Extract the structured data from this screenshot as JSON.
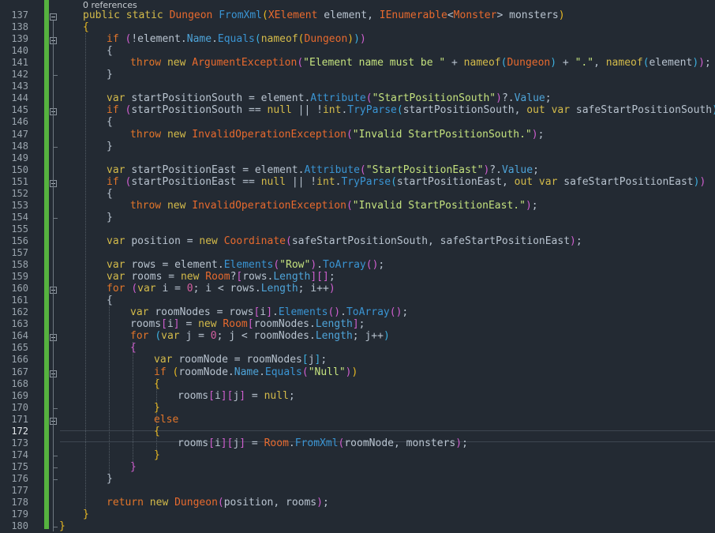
{
  "codelens": "0 references",
  "current_line": 172,
  "colors": {
    "background": "#232a33",
    "change_bar": "#56b23f",
    "keyword": "#e2752a",
    "type": "#e86a2e",
    "method": "#3a95d4",
    "string": "#c4e27e"
  },
  "line_numbers": [
    "137",
    "138",
    "139",
    "140",
    "141",
    "142",
    "143",
    "144",
    "145",
    "146",
    "147",
    "148",
    "149",
    "150",
    "151",
    "152",
    "153",
    "154",
    "155",
    "156",
    "157",
    "158",
    "159",
    "160",
    "161",
    "162",
    "163",
    "164",
    "165",
    "166",
    "167",
    "168",
    "169",
    "170",
    "171",
    "172",
    "173",
    "174",
    "175",
    "176",
    "177",
    "178",
    "179",
    "180"
  ],
  "code_lines": [
    {
      "ln": "137",
      "tokens": [
        [
          "kw2",
          "public "
        ],
        [
          "kw2",
          "static "
        ],
        [
          "ty",
          "Dungeon "
        ],
        [
          "fn",
          "FromXml"
        ],
        [
          "p1",
          "("
        ],
        [
          "ty",
          "XElement "
        ],
        [
          "id",
          "element, "
        ],
        [
          "ty",
          "IEnumerable"
        ],
        [
          "op",
          "<"
        ],
        [
          "ty",
          "Monster"
        ],
        [
          "op",
          "> "
        ],
        [
          "id",
          "monsters"
        ],
        [
          "p1",
          ")"
        ]
      ]
    },
    {
      "ln": "138",
      "tokens": [
        [
          "p1",
          "{"
        ]
      ]
    },
    {
      "ln": "139",
      "tokens": [
        [
          "kw",
          "if "
        ],
        [
          "p2",
          "("
        ],
        [
          "op",
          "!"
        ],
        [
          "id",
          "element."
        ],
        [
          "pr",
          "Name"
        ],
        [
          "id",
          "."
        ],
        [
          "fn",
          "Equals"
        ],
        [
          "p3",
          "("
        ],
        [
          "kw2",
          "nameof"
        ],
        [
          "p1",
          "("
        ],
        [
          "ty",
          "Dungeon"
        ],
        [
          "p1",
          ")"
        ],
        [
          "p3",
          ")"
        ],
        [
          "p2",
          ")"
        ]
      ]
    },
    {
      "ln": "140",
      "tokens": [
        [
          "op",
          "{"
        ]
      ]
    },
    {
      "ln": "141",
      "tokens": [
        [
          "kw",
          "throw "
        ],
        [
          "kw2",
          "new "
        ],
        [
          "ty",
          "ArgumentException"
        ],
        [
          "p2",
          "("
        ],
        [
          "str",
          "\"Element name must be \""
        ],
        [
          "op",
          " + "
        ],
        [
          "kw2",
          "nameof"
        ],
        [
          "p3",
          "("
        ],
        [
          "ty",
          "Dungeon"
        ],
        [
          "p3",
          ")"
        ],
        [
          "op",
          " + "
        ],
        [
          "str",
          "\".\""
        ],
        [
          "op",
          ", "
        ],
        [
          "kw2",
          "nameof"
        ],
        [
          "p3",
          "("
        ],
        [
          "id",
          "element"
        ],
        [
          "p3",
          ")"
        ],
        [
          "p2",
          ")"
        ],
        [
          "op",
          ";"
        ]
      ]
    },
    {
      "ln": "142",
      "tokens": [
        [
          "op",
          "}"
        ]
      ]
    },
    {
      "ln": "143",
      "tokens": []
    },
    {
      "ln": "144",
      "tokens": [
        [
          "kw2",
          "var "
        ],
        [
          "id",
          "startPositionSouth = element."
        ],
        [
          "fn",
          "Attribute"
        ],
        [
          "p2",
          "("
        ],
        [
          "str",
          "\"StartPositionSouth\""
        ],
        [
          "p2",
          ")"
        ],
        [
          "op",
          "?."
        ],
        [
          "pr",
          "Value"
        ],
        [
          "op",
          ";"
        ]
      ]
    },
    {
      "ln": "145",
      "tokens": [
        [
          "kw",
          "if "
        ],
        [
          "p2",
          "("
        ],
        [
          "id",
          "startPositionSouth == "
        ],
        [
          "kw2",
          "null"
        ],
        [
          "op",
          " || !"
        ],
        [
          "kw2",
          "int"
        ],
        [
          "op",
          "."
        ],
        [
          "fn",
          "TryParse"
        ],
        [
          "p3",
          "("
        ],
        [
          "id",
          "startPositionSouth, "
        ],
        [
          "kw2",
          "out var "
        ],
        [
          "id",
          "safeStartPositionSouth"
        ],
        [
          "p3",
          ")"
        ],
        [
          "p2",
          ")"
        ]
      ]
    },
    {
      "ln": "146",
      "tokens": [
        [
          "op",
          "{"
        ]
      ]
    },
    {
      "ln": "147",
      "tokens": [
        [
          "kw",
          "throw "
        ],
        [
          "kw2",
          "new "
        ],
        [
          "ty",
          "InvalidOperationException"
        ],
        [
          "p2",
          "("
        ],
        [
          "str",
          "\"Invalid StartPositionSouth.\""
        ],
        [
          "p2",
          ")"
        ],
        [
          "op",
          ";"
        ]
      ]
    },
    {
      "ln": "148",
      "tokens": [
        [
          "op",
          "}"
        ]
      ]
    },
    {
      "ln": "149",
      "tokens": []
    },
    {
      "ln": "150",
      "tokens": [
        [
          "kw2",
          "var "
        ],
        [
          "id",
          "startPositionEast = element."
        ],
        [
          "fn",
          "Attribute"
        ],
        [
          "p2",
          "("
        ],
        [
          "str",
          "\"StartPositionEast\""
        ],
        [
          "p2",
          ")"
        ],
        [
          "op",
          "?."
        ],
        [
          "pr",
          "Value"
        ],
        [
          "op",
          ";"
        ]
      ]
    },
    {
      "ln": "151",
      "tokens": [
        [
          "kw",
          "if "
        ],
        [
          "p2",
          "("
        ],
        [
          "id",
          "startPositionEast == "
        ],
        [
          "kw2",
          "null"
        ],
        [
          "op",
          " || !"
        ],
        [
          "kw2",
          "int"
        ],
        [
          "op",
          "."
        ],
        [
          "fn",
          "TryParse"
        ],
        [
          "p3",
          "("
        ],
        [
          "id",
          "startPositionEast, "
        ],
        [
          "kw2",
          "out var "
        ],
        [
          "id",
          "safeStartPositionEast"
        ],
        [
          "p3",
          ")"
        ],
        [
          "p2",
          ")"
        ]
      ]
    },
    {
      "ln": "152",
      "tokens": [
        [
          "op",
          "{"
        ]
      ]
    },
    {
      "ln": "153",
      "tokens": [
        [
          "kw",
          "throw "
        ],
        [
          "kw2",
          "new "
        ],
        [
          "ty",
          "InvalidOperationException"
        ],
        [
          "p2",
          "("
        ],
        [
          "str",
          "\"Invalid StartPositionEast.\""
        ],
        [
          "p2",
          ")"
        ],
        [
          "op",
          ";"
        ]
      ]
    },
    {
      "ln": "154",
      "tokens": [
        [
          "op",
          "}"
        ]
      ]
    },
    {
      "ln": "155",
      "tokens": []
    },
    {
      "ln": "156",
      "tokens": [
        [
          "kw2",
          "var "
        ],
        [
          "id",
          "position = "
        ],
        [
          "kw2",
          "new "
        ],
        [
          "ty",
          "Coordinate"
        ],
        [
          "p2",
          "("
        ],
        [
          "id",
          "safeStartPositionSouth, safeStartPositionEast"
        ],
        [
          "p2",
          ")"
        ],
        [
          "op",
          ";"
        ]
      ]
    },
    {
      "ln": "157",
      "tokens": []
    },
    {
      "ln": "158",
      "tokens": [
        [
          "kw2",
          "var "
        ],
        [
          "id",
          "rows = element."
        ],
        [
          "fn",
          "Elements"
        ],
        [
          "p2",
          "("
        ],
        [
          "str",
          "\"Row\""
        ],
        [
          "p2",
          ")"
        ],
        [
          "op",
          "."
        ],
        [
          "fn",
          "ToArray"
        ],
        [
          "p2",
          "()"
        ],
        [
          "op",
          ";"
        ]
      ]
    },
    {
      "ln": "159",
      "tokens": [
        [
          "kw2",
          "var "
        ],
        [
          "id",
          "rooms = "
        ],
        [
          "kw2",
          "new "
        ],
        [
          "ty",
          "Room"
        ],
        [
          "op",
          "?"
        ],
        [
          "p2",
          "["
        ],
        [
          "id",
          "rows."
        ],
        [
          "pr",
          "Length"
        ],
        [
          "p2",
          "]"
        ],
        [
          "p2",
          "[]"
        ],
        [
          "op",
          ";"
        ]
      ]
    },
    {
      "ln": "160",
      "tokens": [
        [
          "kw",
          "for "
        ],
        [
          "p2",
          "("
        ],
        [
          "kw2",
          "var "
        ],
        [
          "id",
          "i = "
        ],
        [
          "num",
          "0"
        ],
        [
          "op",
          "; "
        ],
        [
          "id",
          "i < rows."
        ],
        [
          "pr",
          "Length"
        ],
        [
          "op",
          "; "
        ],
        [
          "id",
          "i++"
        ],
        [
          "p2",
          ")"
        ]
      ]
    },
    {
      "ln": "161",
      "tokens": [
        [
          "op",
          "{"
        ]
      ]
    },
    {
      "ln": "162",
      "tokens": [
        [
          "kw2",
          "var "
        ],
        [
          "id",
          "roomNodes = rows"
        ],
        [
          "p2",
          "["
        ],
        [
          "id",
          "i"
        ],
        [
          "p2",
          "]"
        ],
        [
          "op",
          "."
        ],
        [
          "fn",
          "Elements"
        ],
        [
          "p2",
          "()"
        ],
        [
          "op",
          "."
        ],
        [
          "fn",
          "ToArray"
        ],
        [
          "p2",
          "()"
        ],
        [
          "op",
          ";"
        ]
      ]
    },
    {
      "ln": "163",
      "tokens": [
        [
          "id",
          "rooms"
        ],
        [
          "p2",
          "["
        ],
        [
          "id",
          "i"
        ],
        [
          "p2",
          "]"
        ],
        [
          "op",
          " = "
        ],
        [
          "kw2",
          "new "
        ],
        [
          "ty",
          "Room"
        ],
        [
          "p2",
          "["
        ],
        [
          "id",
          "roomNodes."
        ],
        [
          "pr",
          "Length"
        ],
        [
          "p2",
          "]"
        ],
        [
          "op",
          ";"
        ]
      ]
    },
    {
      "ln": "164",
      "tokens": [
        [
          "kw",
          "for "
        ],
        [
          "p3",
          "("
        ],
        [
          "kw2",
          "var "
        ],
        [
          "id",
          "j = "
        ],
        [
          "num",
          "0"
        ],
        [
          "op",
          "; "
        ],
        [
          "id",
          "j < roomNodes."
        ],
        [
          "pr",
          "Length"
        ],
        [
          "op",
          "; "
        ],
        [
          "id",
          "j++"
        ],
        [
          "p3",
          ")"
        ]
      ]
    },
    {
      "ln": "165",
      "tokens": [
        [
          "p2",
          "{"
        ]
      ]
    },
    {
      "ln": "166",
      "tokens": [
        [
          "kw2",
          "var "
        ],
        [
          "id",
          "roomNode = roomNodes"
        ],
        [
          "p3",
          "["
        ],
        [
          "id",
          "j"
        ],
        [
          "p3",
          "]"
        ],
        [
          "op",
          ";"
        ]
      ]
    },
    {
      "ln": "167",
      "tokens": [
        [
          "kw",
          "if "
        ],
        [
          "p1",
          "("
        ],
        [
          "id",
          "roomNode."
        ],
        [
          "pr",
          "Name"
        ],
        [
          "op",
          "."
        ],
        [
          "fn",
          "Equals"
        ],
        [
          "p2",
          "("
        ],
        [
          "str",
          "\"Null\""
        ],
        [
          "p2",
          ")"
        ],
        [
          "p1",
          ")"
        ]
      ]
    },
    {
      "ln": "168",
      "tokens": [
        [
          "p1",
          "{"
        ]
      ]
    },
    {
      "ln": "169",
      "tokens": [
        [
          "id",
          "rooms"
        ],
        [
          "p2",
          "["
        ],
        [
          "id",
          "i"
        ],
        [
          "p2",
          "]"
        ],
        [
          "p2",
          "["
        ],
        [
          "id",
          "j"
        ],
        [
          "p2",
          "]"
        ],
        [
          "op",
          " = "
        ],
        [
          "kw2",
          "null"
        ],
        [
          "op",
          ";"
        ]
      ]
    },
    {
      "ln": "170",
      "tokens": [
        [
          "p1",
          "}"
        ]
      ]
    },
    {
      "ln": "171",
      "tokens": [
        [
          "kw",
          "else"
        ]
      ]
    },
    {
      "ln": "172",
      "tokens": [
        [
          "p1",
          "{"
        ]
      ]
    },
    {
      "ln": "173",
      "tokens": [
        [
          "id",
          "rooms"
        ],
        [
          "p2",
          "["
        ],
        [
          "id",
          "i"
        ],
        [
          "p2",
          "]"
        ],
        [
          "p2",
          "["
        ],
        [
          "id",
          "j"
        ],
        [
          "p2",
          "]"
        ],
        [
          "op",
          " = "
        ],
        [
          "ty",
          "Room"
        ],
        [
          "op",
          "."
        ],
        [
          "fn",
          "FromXml"
        ],
        [
          "p2",
          "("
        ],
        [
          "id",
          "roomNode, monsters"
        ],
        [
          "p2",
          ")"
        ],
        [
          "op",
          ";"
        ]
      ]
    },
    {
      "ln": "174",
      "tokens": [
        [
          "p1",
          "}"
        ]
      ]
    },
    {
      "ln": "175",
      "tokens": [
        [
          "p2",
          "}"
        ]
      ]
    },
    {
      "ln": "176",
      "tokens": [
        [
          "op",
          "}"
        ]
      ]
    },
    {
      "ln": "177",
      "tokens": []
    },
    {
      "ln": "178",
      "tokens": [
        [
          "kw",
          "return "
        ],
        [
          "kw2",
          "new "
        ],
        [
          "ty",
          "Dungeon"
        ],
        [
          "p2",
          "("
        ],
        [
          "id",
          "position, rooms"
        ],
        [
          "p2",
          ")"
        ],
        [
          "op",
          ";"
        ]
      ]
    },
    {
      "ln": "179",
      "tokens": [
        [
          "p1",
          "}"
        ]
      ]
    },
    {
      "ln": "180",
      "tokens": [
        [
          "p1",
          "}"
        ]
      ]
    }
  ]
}
